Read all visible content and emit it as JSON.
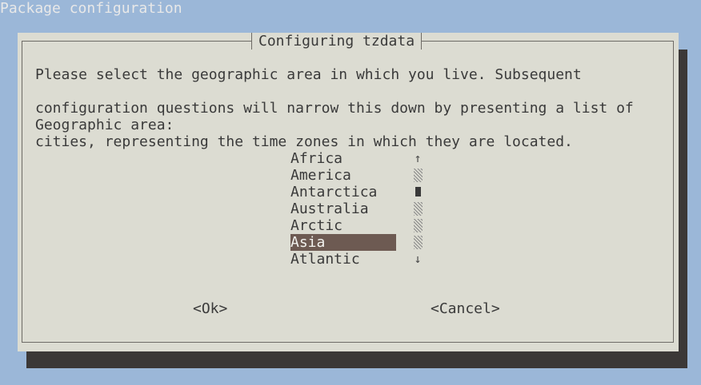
{
  "backtitle": "Package configuration",
  "dialog": {
    "title": "Configuring tzdata",
    "prompt_lines": [
      "Please select the geographic area in which you live. Subsequent",
      "configuration questions will narrow this down by presenting a list of",
      "cities, representing the time zones in which they are located."
    ],
    "area_label": "Geographic area:",
    "menu": {
      "items": [
        "Africa",
        "America",
        "Antarctica",
        "Australia",
        "Arctic",
        "Asia",
        "Atlantic"
      ],
      "selected": "Asia"
    },
    "scrollbar": {
      "up_arrow": "↑",
      "down_arrow": "↓"
    },
    "buttons": {
      "ok": "<Ok>",
      "cancel": "<Cancel>"
    }
  }
}
